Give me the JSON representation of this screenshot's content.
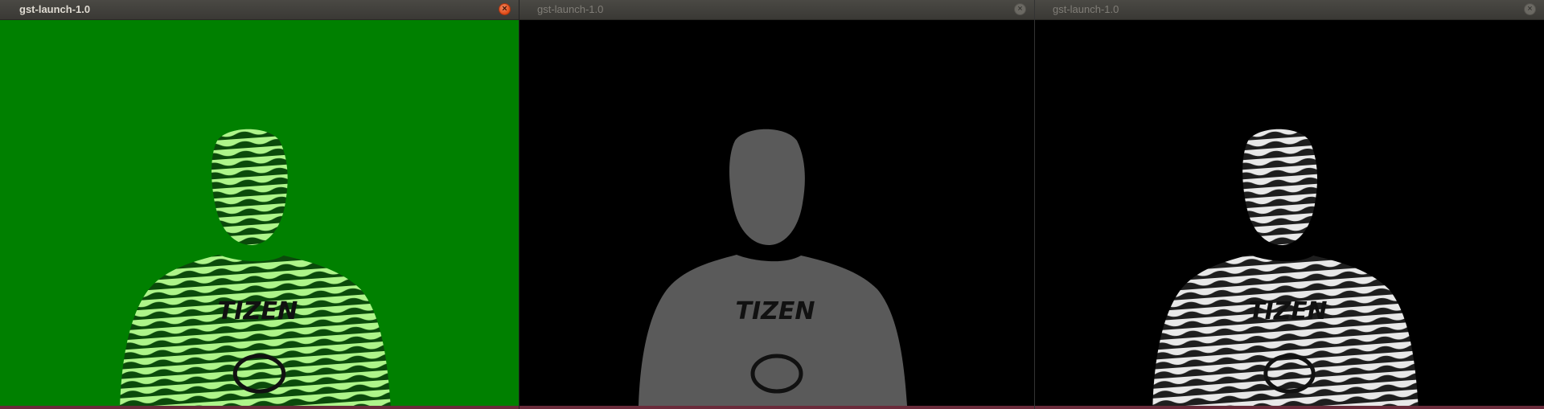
{
  "windows": [
    {
      "title": "gst-launch-1.0",
      "state": "active",
      "view": "depth-colormap-green",
      "background": "#008000",
      "figure_fill": "#2fa82f",
      "stripe_light": "#aef58a",
      "stripe_dark": "#0b4a0b",
      "shirt_text": "TIZEN"
    },
    {
      "title": "gst-launch-1.0",
      "state": "inactive",
      "view": "depth-grayscale",
      "background": "#000000",
      "figure_fill": "#5a5a5a",
      "stripe_light": "#6a6a6a",
      "stripe_dark": "#3e3e3e",
      "shirt_text": "TIZEN"
    },
    {
      "title": "gst-launch-1.0",
      "state": "inactive",
      "view": "depth-colormap-gray",
      "background": "#000000",
      "figure_fill": "#8a8a8a",
      "stripe_light": "#e8e8e8",
      "stripe_dark": "#1e1e1e",
      "shirt_text": "TIZEN"
    }
  ],
  "icons": {
    "close": "close-icon"
  },
  "colors": {
    "titlebar": "#3c3b37",
    "active_close": "#df4a16",
    "inactive_close": "#6b6963"
  }
}
